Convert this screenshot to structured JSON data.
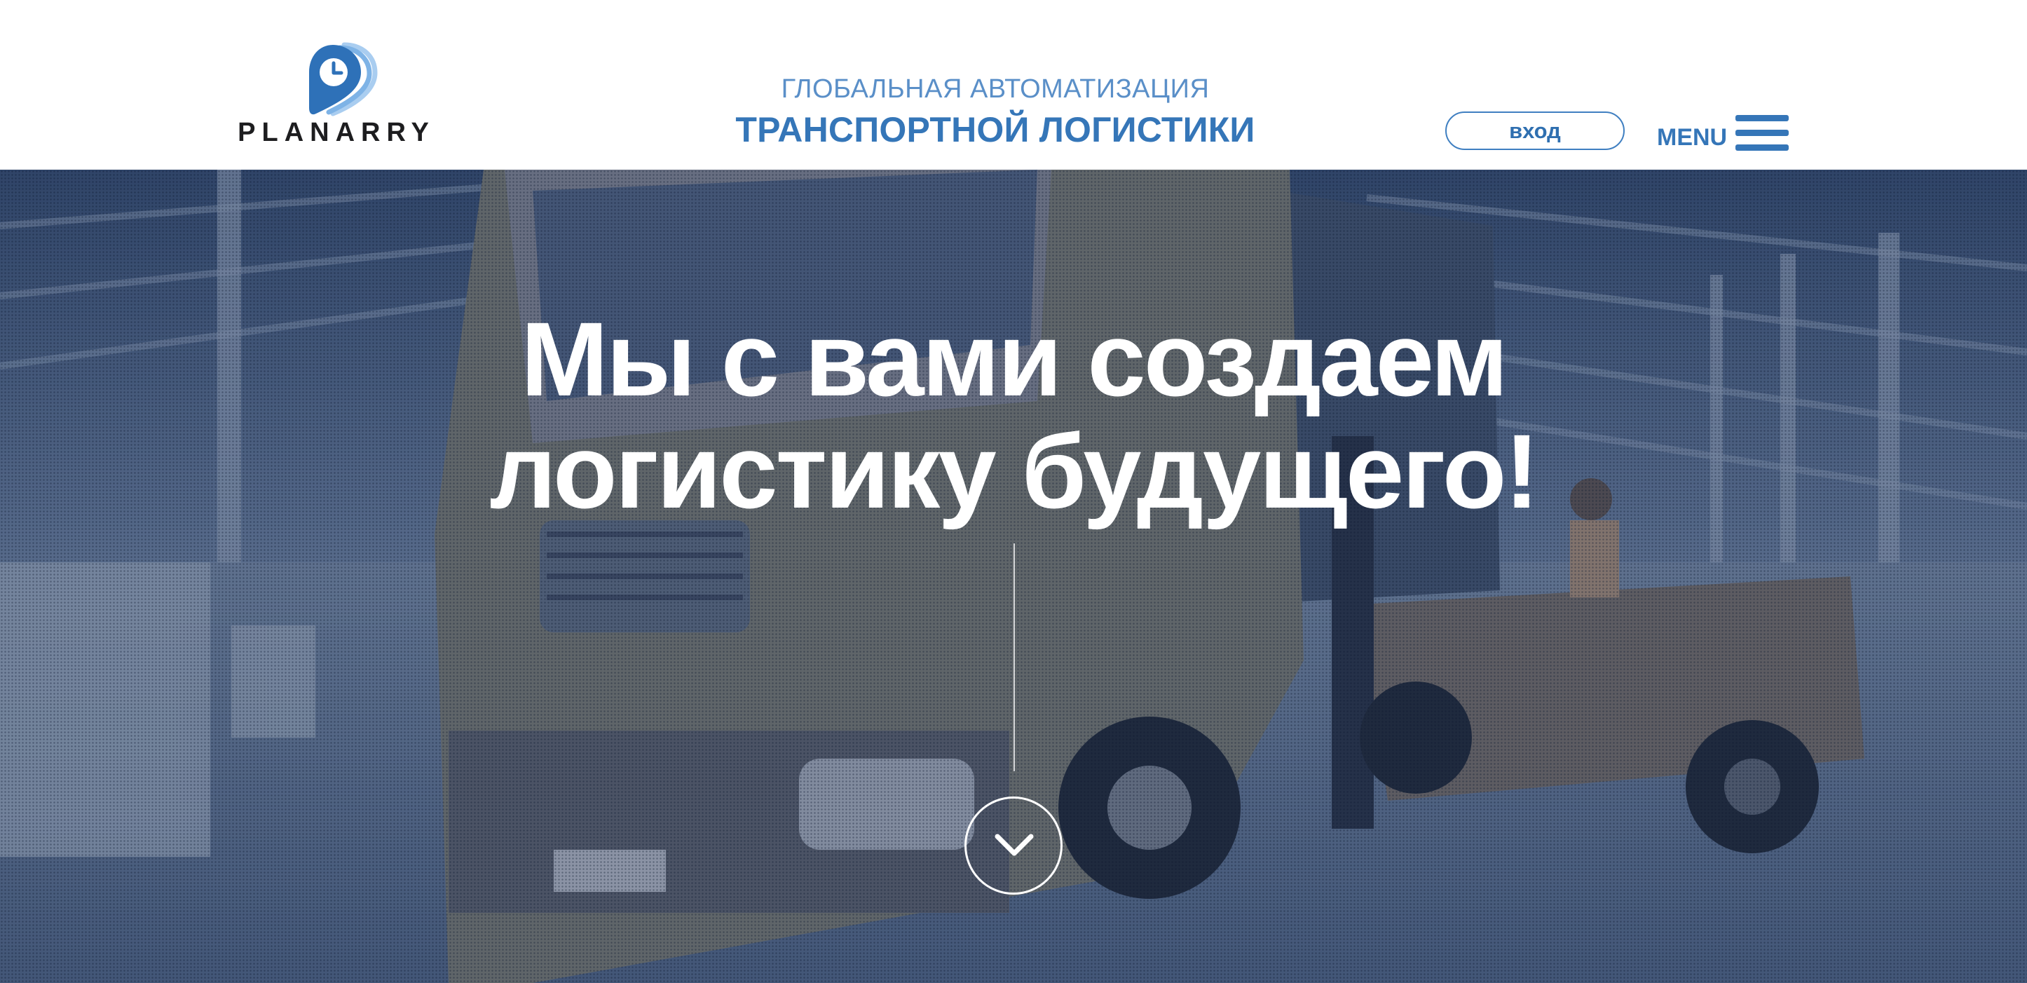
{
  "header": {
    "logo_text": "PLANARRY",
    "tagline_top": "ГЛОБАЛЬНАЯ АВТОМАТИЗАЦИЯ",
    "tagline_bottom": "ТРАНСПОРТНОЙ ЛОГИСТИКИ",
    "login_label": "вход",
    "menu_label": "MENU"
  },
  "hero": {
    "title_line1": "Мы с вами создаем",
    "title_line2": "логистику будущего!",
    "scroll_icon": "chevron-down-icon"
  },
  "colors": {
    "brand_blue": "#3576b8",
    "brand_light_blue": "#5a8fc8",
    "logo_dark": "#1d1d1f",
    "hero_tint": "#33496a"
  },
  "icons": {
    "logo_mark": "clock-pin-icon",
    "menu": "hamburger-icon",
    "scroll": "chevron-down-icon"
  }
}
